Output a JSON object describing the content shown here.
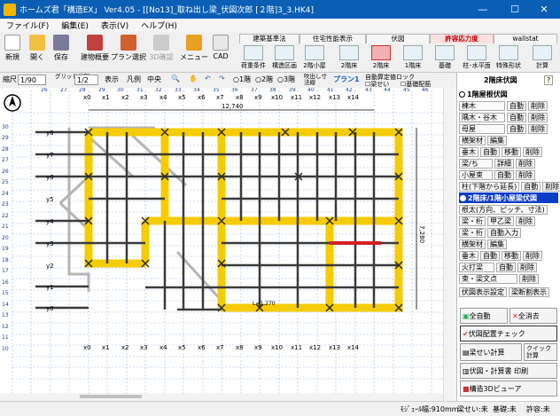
{
  "window": {
    "title": "ホームズ君「構造EX」 Ver4.05 - [[No13]_取ね出し梁_伏図次郎 [２階]3_3.HK4]",
    "minimize": "—",
    "maximize": "☐",
    "close": "✕"
  },
  "menu": [
    "ファイル(F)",
    "編集(E)",
    "表示(V)",
    "ヘルプ(H)"
  ],
  "toolbar": {
    "buttons": [
      "新規",
      "開く",
      "保存",
      "建物概要",
      "プラン選択",
      "3D確認",
      "メニュー",
      "CAD"
    ],
    "tabs": [
      "建築基準法",
      "住宅性能表示",
      "伏図",
      "許容応力度",
      "wallstat"
    ],
    "modes": [
      "荷重条件",
      "構造区画",
      "2階小屋",
      "2階床",
      "2階床",
      "1階床",
      "基礎",
      "柱･水平面",
      "特殊形状",
      "計算"
    ]
  },
  "options": {
    "scale_label": "縮尺",
    "scale_value": "1/90",
    "grid_label": "グリッド分割",
    "grid_value": "1/2",
    "display": "表示",
    "legend": "凡例",
    "center": "中央",
    "floors": [
      "1階",
      "2階",
      "3階"
    ],
    "blowout": "吹出し寸法線",
    "plan": "プラン1",
    "autolock": "自動算定値ロック",
    "beam": "梁せい",
    "floor_beam": "基礎配筋"
  },
  "canvas": {
    "dimension_top": "12,740",
    "dimension_right": "7,280",
    "dimension_label": "L=1,270",
    "x_labels": [
      "x0",
      "x1",
      "x2",
      "x3",
      "x4",
      "x5",
      "x6",
      "x7",
      "x8",
      "x9",
      "x10",
      "x11",
      "x12",
      "x13",
      "x14"
    ],
    "y_labels": [
      "y8",
      "y7",
      "y6",
      "y5",
      "y4",
      "y3",
      "y2",
      "y1",
      "y0"
    ],
    "top_ruler": [
      "26",
      "27",
      "28",
      "29",
      "30",
      "31",
      "32",
      "33",
      "34",
      "35",
      "36",
      "37",
      "38",
      "39",
      "40",
      "41",
      "42",
      "43",
      "44",
      "45",
      "46",
      "47"
    ],
    "left_ruler": [
      "30",
      "29",
      "28",
      "27",
      "26",
      "25",
      "24",
      "23",
      "22",
      "21",
      "20",
      "19",
      "18",
      "17",
      "16",
      "15",
      "14",
      "13",
      "12",
      "11",
      "10"
    ]
  },
  "rpanel": {
    "title": "2階床伏図",
    "section1": "1階屋根伏図",
    "items1": [
      [
        "棟木",
        "自動",
        "削除"
      ],
      [
        "隅木・谷木",
        "自動",
        "削除"
      ],
      [
        "母屋",
        "自動",
        "削除"
      ],
      [
        "横架材",
        "編集",
        ""
      ],
      [
        "垂木",
        "自動",
        "移動",
        "削除"
      ],
      [
        "梁/ち",
        "詳細",
        "削除"
      ],
      [
        "小屋束",
        "自動",
        "削除"
      ],
      [
        "柱(下階から延長)",
        "自動",
        "削除"
      ]
    ],
    "section2": "2階床/1階小屋梁伏図",
    "items2": [
      [
        "根太(方向、ピッチ、寸法)"
      ],
      [
        "梁・桁",
        "甲乙梁",
        "削除"
      ],
      [
        "梁・桁",
        "自動入力"
      ],
      [
        "横架材",
        "編集",
        ""
      ],
      [
        "垂木",
        "自動",
        "移動",
        "削除"
      ],
      [
        "火打梁",
        "自動",
        "削除"
      ],
      [
        "束・梁文点",
        "削除"
      ]
    ],
    "footer_row": [
      "伏図表示設定",
      "梁断割表示"
    ],
    "auto_all": "全自動",
    "clear_all": "全消去",
    "check": "伏図配置チェック",
    "beam_calc": "梁せい計算",
    "quick": "クイック計算",
    "print": "伏図・計算書 印刷",
    "viewer": "構造3Dビューア"
  },
  "status": {
    "module": "ﾓｼﾞｭｰﾙ幅:910mm",
    "beam_state": "梁せい:未",
    "found_state": "基礎:未",
    "allow_state": "許容:未"
  },
  "colors": {
    "title": "#0a5fb4",
    "beam_yellow": "#f5cc00",
    "member": "#3a3a3a",
    "highlight": "#d32020",
    "section": "#0a3cc9"
  }
}
